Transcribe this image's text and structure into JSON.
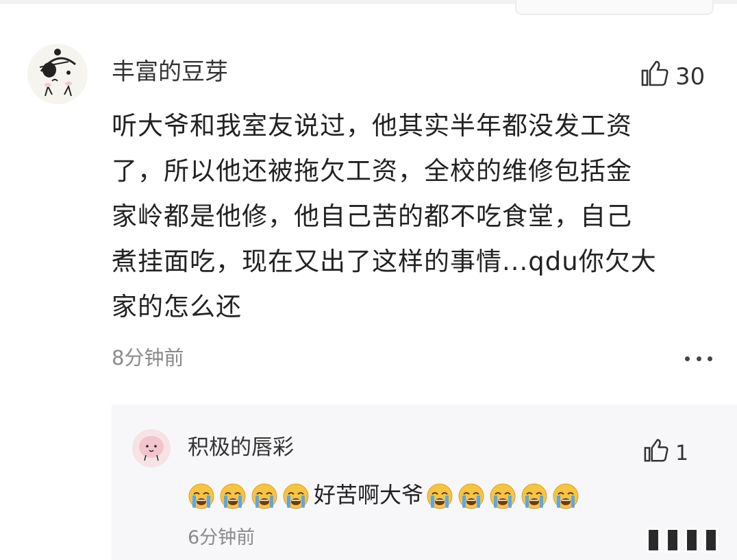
{
  "comment": {
    "username": "丰富的豆芽",
    "like_count": "30",
    "text_lines": [
      "听大爷和我室友说过，他其实半年都没发工资",
      "了，所以他还被拖欠工资，全校的维修包括金",
      "家岭都是他修，他自己苦的都不吃食堂，自己",
      "煮挂面吃，现在又出了这样的事情...qdu你欠大",
      "家的怎么还"
    ],
    "timestamp": "8分钟前"
  },
  "reply": {
    "username": "积极的唇彩",
    "like_count": "1",
    "text": "好苦啊大爷",
    "leading_emoji_count": 4,
    "trailing_emoji_count": 5,
    "emoji_name": "loudly-crying-face",
    "timestamp": "6分钟前"
  },
  "icons": {
    "like": "thumbs-up-icon",
    "more": "more-dots-icon"
  },
  "colors": {
    "text": "#222222",
    "secondary_text": "#8a8a8a",
    "reply_background": "#f7f7f9",
    "emoji_face": "#f6c443",
    "emoji_tears": "#5aa7e8"
  }
}
